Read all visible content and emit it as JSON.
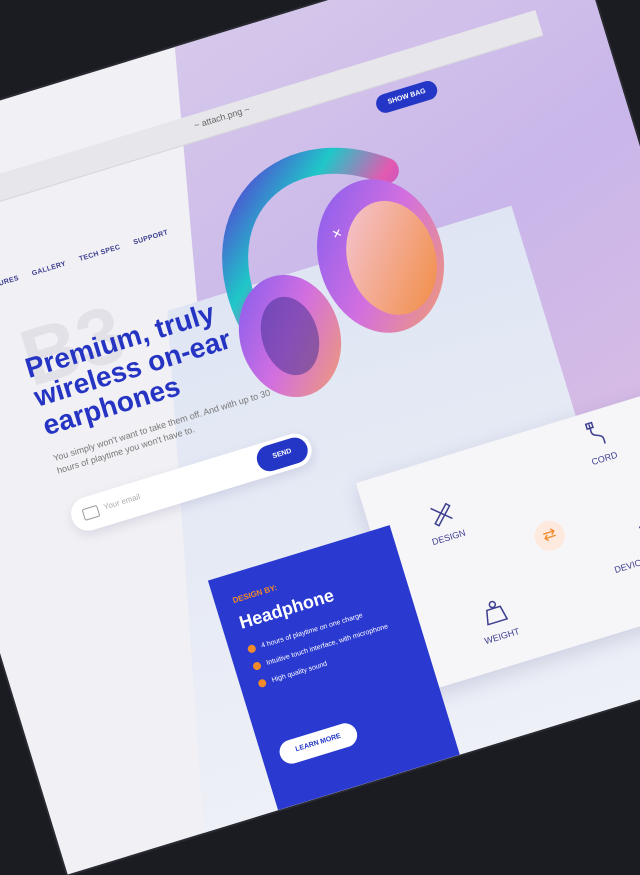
{
  "browser": {
    "tab_title": "~ attach.png ~"
  },
  "nav": {
    "items": [
      "FEATURES",
      "GALLERY",
      "TECH SPEC",
      "SUPPORT"
    ]
  },
  "header": {
    "show_bag_label": "SHOW BAG"
  },
  "hero": {
    "watermark": "B3",
    "headline": "Premium, truly wireless on-ear earphones",
    "subtext": "You simply won't want to take them off. And with up to 30 hours of playtime you won't have to."
  },
  "subscribe": {
    "placeholder": "Your email",
    "send_label": "SEND"
  },
  "features": {
    "items": [
      {
        "label": "DESIGN",
        "icon": "pencil-ruler-icon"
      },
      {
        "label": "CORD",
        "icon": "cord-icon"
      },
      {
        "label": "WEIGHT",
        "icon": "weight-icon"
      },
      {
        "label": "DEVICE CONTROLS",
        "icon": "hand-touch-icon"
      }
    ]
  },
  "promo": {
    "kicker": "DESIGN BY:",
    "title": "Headphone",
    "bullets": [
      "4 hours of playtime on one charge",
      "Intuitive touch interface, with microphone",
      "High quality sound"
    ],
    "cta_label": "LEARN MORE"
  },
  "colors": {
    "accent": "#2436C6",
    "orange": "#F08A2A",
    "lilac": "#C9B6EA"
  }
}
